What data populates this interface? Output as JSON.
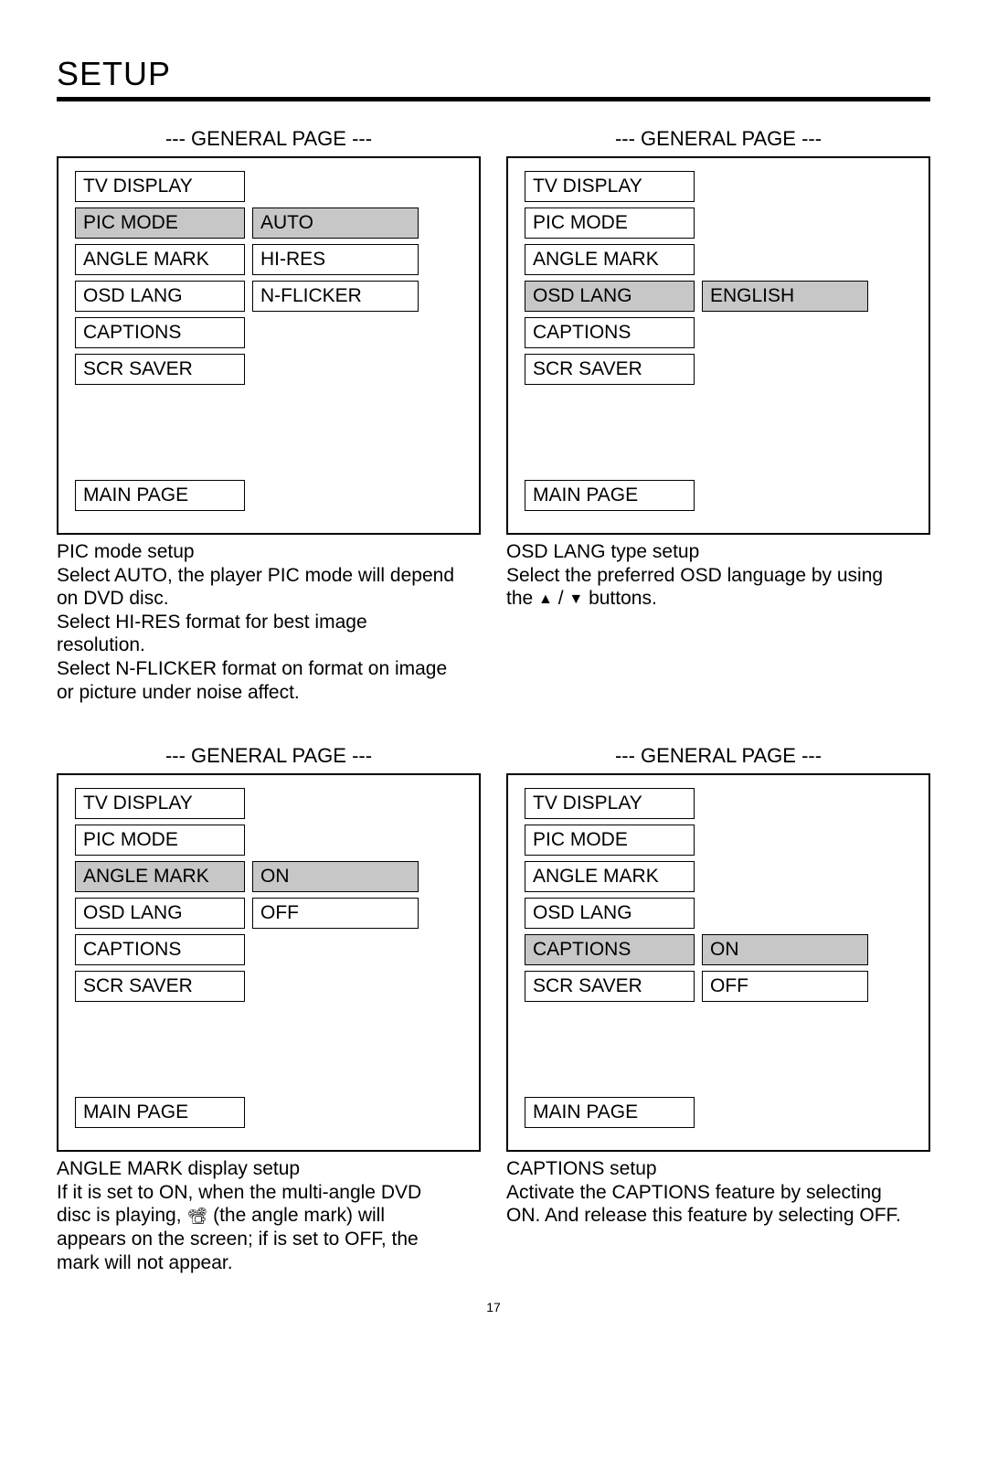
{
  "page_title": "SETUP",
  "panels": [
    {
      "title": "--- GENERAL PAGE ---",
      "rows": [
        {
          "left": "TV DISPLAY"
        },
        {
          "left": "PIC MODE",
          "left_sel": true,
          "right": "AUTO",
          "right_sel": true
        },
        {
          "left": "ANGLE MARK",
          "right": "HI-RES"
        },
        {
          "left": "OSD LANG",
          "right": "N-FLICKER"
        },
        {
          "left": "CAPTIONS"
        },
        {
          "left": "SCR SAVER"
        }
      ],
      "main": "MAIN PAGE",
      "caption_head": "PIC mode setup",
      "caption_body": "Select AUTO, the player PIC mode will depend on DVD disc.\nSelect HI-RES format for best image resolution.\nSelect N-FLICKER format on format on image or picture under noise affect."
    },
    {
      "title": "--- GENERAL PAGE ---",
      "rows": [
        {
          "left": "TV DISPLAY"
        },
        {
          "left": "PIC MODE"
        },
        {
          "left": "ANGLE MARK"
        },
        {
          "left": "OSD LANG",
          "left_sel": true,
          "right": "ENGLISH",
          "right_sel": true
        },
        {
          "left": "CAPTIONS"
        },
        {
          "left": "SCR SAVER"
        }
      ],
      "main": "MAIN PAGE",
      "caption_head": "OSD LANG type setup",
      "caption_body_pre": "Select the preferred OSD language by using the ",
      "caption_body_post": " buttons."
    },
    {
      "title": "--- GENERAL PAGE ---",
      "rows": [
        {
          "left": "TV DISPLAY"
        },
        {
          "left": "PIC MODE"
        },
        {
          "left": "ANGLE MARK",
          "left_sel": true,
          "right": "ON",
          "right_sel": true
        },
        {
          "left": "OSD LANG",
          "right": "OFF"
        },
        {
          "left": "CAPTIONS"
        },
        {
          "left": "SCR SAVER"
        }
      ],
      "main": "MAIN PAGE",
      "caption_head": "ANGLE MARK display setup",
      "caption_body_pre": "If it is set to ON, when the multi-angle DVD disc is playing, ",
      "caption_body_mid": " (the angle mark) will appears on the screen; if is set to OFF, the mark will not appear."
    },
    {
      "title": "--- GENERAL PAGE ---",
      "rows": [
        {
          "left": "TV DISPLAY"
        },
        {
          "left": "PIC MODE"
        },
        {
          "left": "ANGLE MARK"
        },
        {
          "left": "OSD LANG"
        },
        {
          "left": "CAPTIONS",
          "left_sel": true,
          "right": "ON",
          "right_sel": true
        },
        {
          "left": "SCR SAVER",
          "right": "OFF"
        }
      ],
      "main": "MAIN PAGE",
      "caption_head": "CAPTIONS setup",
      "caption_body": "Activate the CAPTIONS feature by selecting ON.  And release this feature by selecting OFF."
    }
  ],
  "page_number": "17"
}
